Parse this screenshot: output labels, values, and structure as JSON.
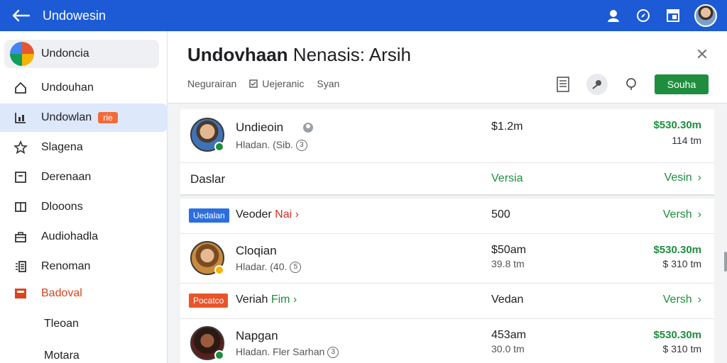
{
  "topbar": {
    "title": "Undowesin",
    "icons": [
      "back-arrow-icon",
      "person-icon",
      "compass-icon",
      "window-icon"
    ]
  },
  "sidebar": {
    "items": [
      {
        "label": "Undoncia",
        "icon": "app-logo"
      },
      {
        "label": "Undouhan",
        "icon": "home-icon"
      },
      {
        "label": "Undowlan",
        "icon": "chart-icon",
        "badge": "rie"
      },
      {
        "label": "Slagena",
        "icon": "star-icon"
      },
      {
        "label": "Derenaan",
        "icon": "box-icon"
      },
      {
        "label": "Dlooons",
        "icon": "book-icon"
      },
      {
        "label": "Audiohadla",
        "icon": "briefcase-icon"
      },
      {
        "label": "Renoman",
        "icon": "list-icon"
      },
      {
        "label": "Badoval",
        "icon": "flag-icon"
      },
      {
        "label": "Tleoan"
      },
      {
        "label": "Motara"
      }
    ]
  },
  "header": {
    "title_bold": "Undovhaan",
    "title_rest": " Nenasis: Arsih",
    "meta": [
      "Negurairan",
      "Uejeranic",
      "Syan"
    ],
    "primary_button": "Souha"
  },
  "rows": {
    "r1": {
      "name": "Undieoin",
      "sub": "Hladan. (Sib.",
      "num": "3",
      "amt": "$1.2m",
      "right": "$530.30m",
      "right_sub": "114 tm"
    },
    "section": {
      "label": "Daslar",
      "mid": "Versia",
      "right": "Vesin"
    },
    "r2": {
      "tag": "Uedalan",
      "label_a": "Veoder ",
      "label_b": "Nai",
      "amt": "500",
      "right": "Versh"
    },
    "r3": {
      "name": "Cloqian",
      "sub": "Hladar. (40.",
      "num": "5",
      "amt": "$50am",
      "amt_sub": "39.8 tm",
      "right": "$530.30m",
      "right_sub": "$ 310 tm"
    },
    "r4": {
      "tag": "Pocatco",
      "label_a": "Veriah ",
      "label_b": "Fim",
      "amt": "Vedan",
      "right": "Versh"
    },
    "r5": {
      "name": "Napgan",
      "sub": "Hladan. Fler Sarhan",
      "num": "3",
      "amt": "453am",
      "amt_sub": "30.0 tm",
      "right": "$530.30m",
      "right_sub": "$ 310 tm"
    }
  },
  "colors": {
    "topbar": "#1c5ad6",
    "accent_green": "#1e8e3e",
    "tag_blue": "#2b6ee0",
    "tag_orange": "#e8552a"
  }
}
